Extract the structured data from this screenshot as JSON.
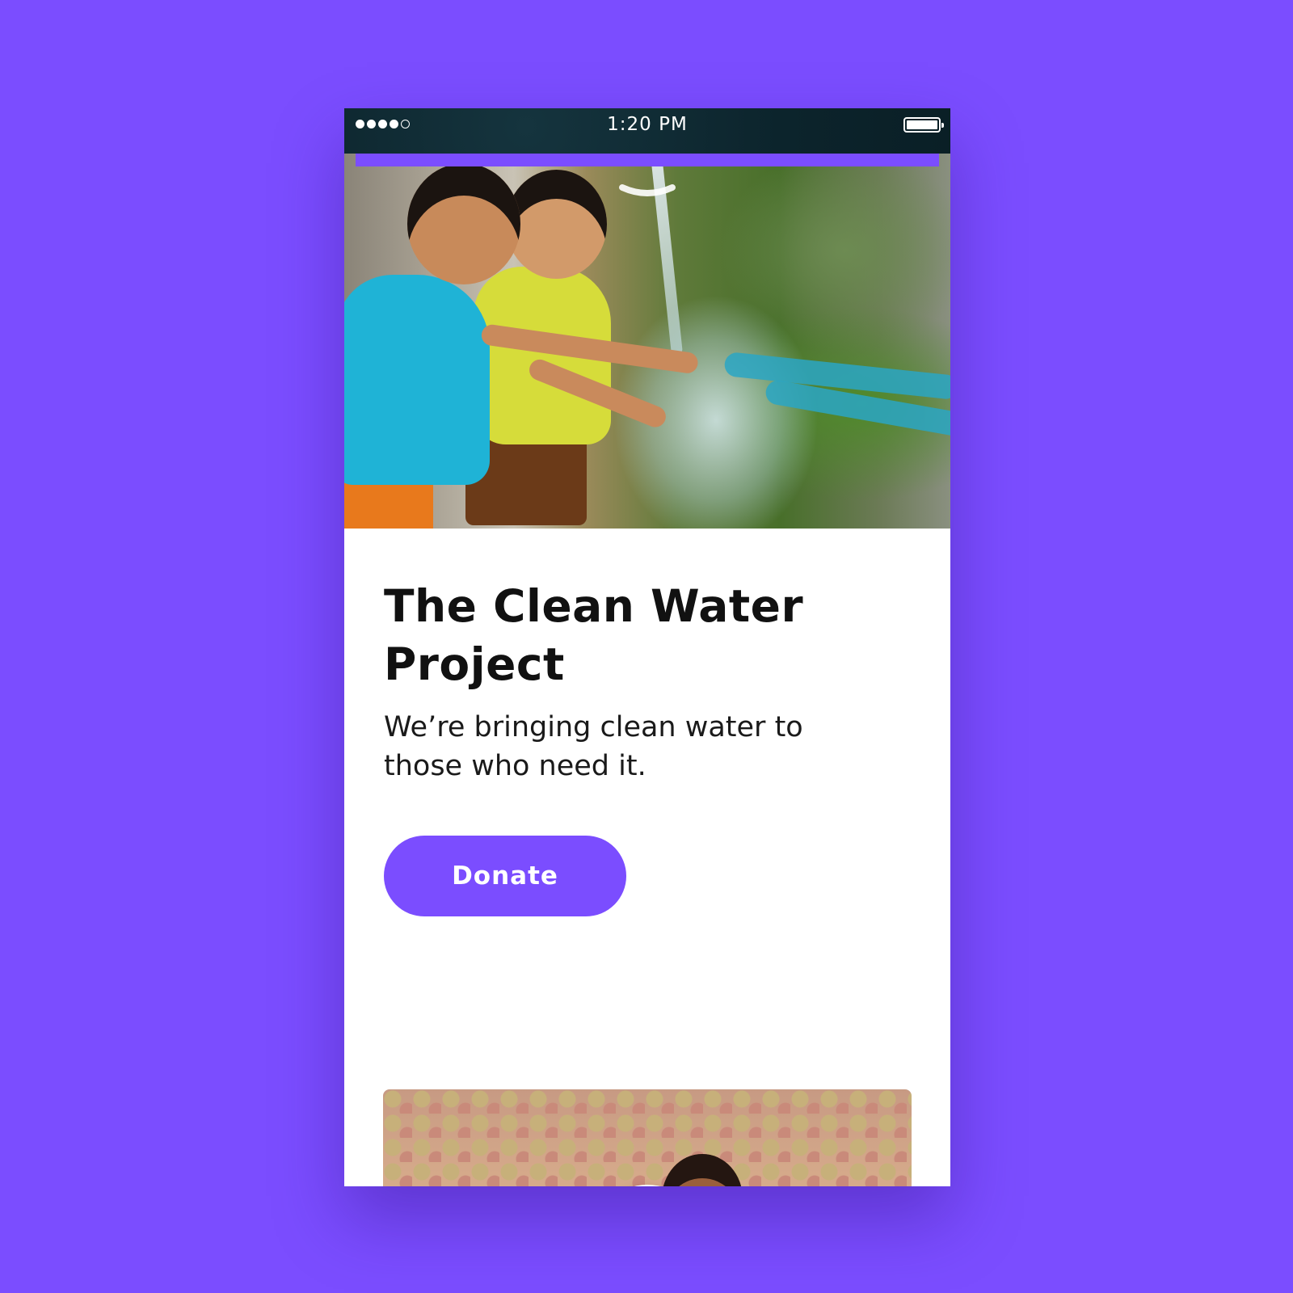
{
  "status_bar": {
    "time": "1:20 PM",
    "signal_bars": 4,
    "signal_total": 5,
    "battery_level": 1.0
  },
  "hero": {
    "image_icon": "children-splashing-water-photo",
    "handle_icon": "chevron-down-handle-icon"
  },
  "project": {
    "title": "The Clean Water Project",
    "description": "We’re bringing clean water to those who need it."
  },
  "actions": {
    "donate_label": "Donate"
  },
  "video": {
    "thumbnail_icon": "smiling-child-photo",
    "play_icon": "play-icon"
  },
  "colors": {
    "background": "#7b4dff",
    "accent": "#7b4dff",
    "card": "#ffffff",
    "text": "#111111",
    "status_bar": "#0e2a33"
  }
}
